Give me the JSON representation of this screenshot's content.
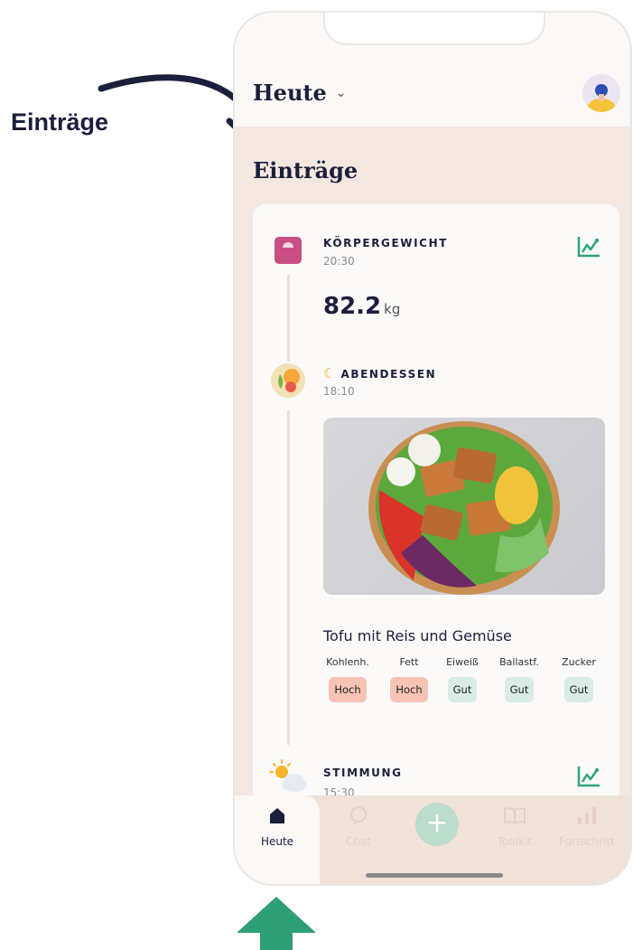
{
  "annotation": {
    "label": "Einträge"
  },
  "header": {
    "title": "Heute"
  },
  "section": {
    "title": "Einträge"
  },
  "entries": {
    "weight": {
      "label": "KÖRPERGEWICHT",
      "time": "20:30",
      "value": "82.2",
      "unit": "kg"
    },
    "dinner": {
      "label": "ABENDESSEN",
      "time": "18:10",
      "meal_name": "Tofu mit Reis und Gemüse",
      "nutrients": [
        {
          "label": "Kohlenh.",
          "rating": "Hoch"
        },
        {
          "label": "Fett",
          "rating": "Hoch"
        },
        {
          "label": "Eiweiß",
          "rating": "Gut"
        },
        {
          "label": "Ballastf.",
          "rating": "Gut"
        },
        {
          "label": "Zucker",
          "rating": "Gut"
        }
      ]
    },
    "mood": {
      "label": "STIMMUNG",
      "time": "15:30"
    }
  },
  "bottom_nav": {
    "items": [
      {
        "label": "Heute",
        "icon": "home-icon"
      },
      {
        "label": "Chat",
        "icon": "chat-icon"
      },
      {
        "label": "+",
        "icon": "add-icon"
      },
      {
        "label": "Toolkit",
        "icon": "book-icon"
      },
      {
        "label": "Fortschritt",
        "icon": "bar-chart-icon"
      }
    ]
  },
  "colors": {
    "accent_green": "#2fa37d",
    "rating_high": "#f6c3b4",
    "rating_good": "#d9ece6",
    "weight_icon": "#c94f82",
    "background": "#f4e7df"
  }
}
